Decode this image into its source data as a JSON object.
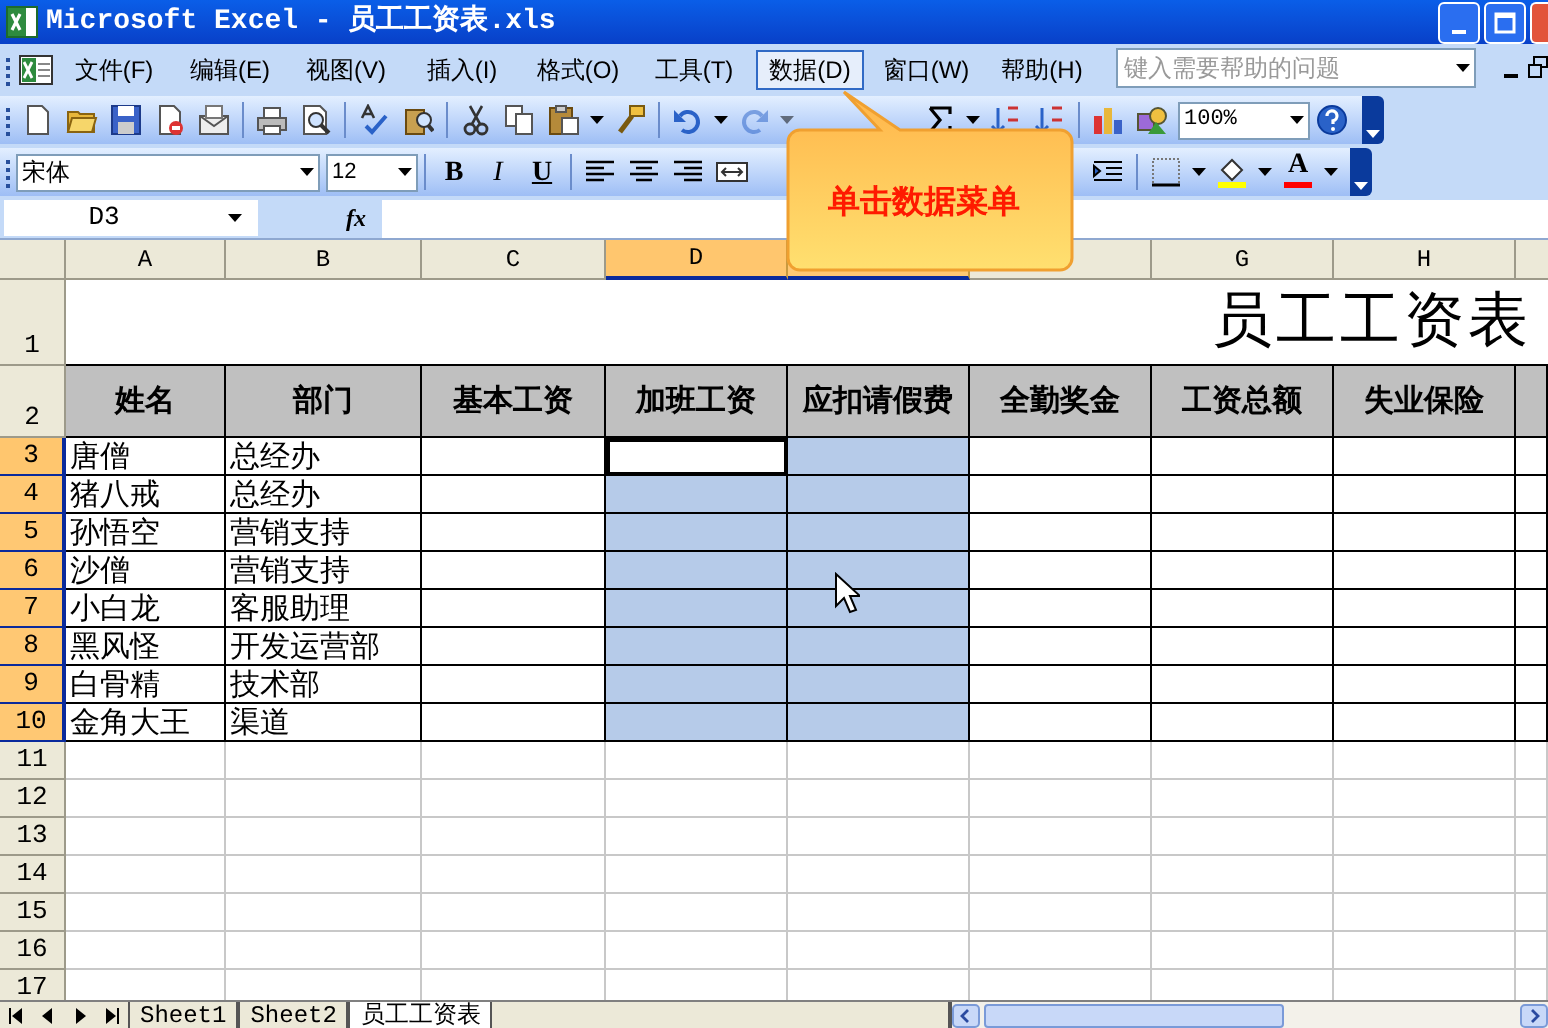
{
  "window": {
    "title": "Microsoft Excel - 员工工资表.xls"
  },
  "menu": [
    {
      "label": "文件(F)",
      "selected": false
    },
    {
      "label": "编辑(E)",
      "selected": false
    },
    {
      "label": "视图(V)",
      "selected": false
    },
    {
      "label": "插入(I)",
      "selected": false
    },
    {
      "label": "格式(O)",
      "selected": false
    },
    {
      "label": "工具(T)",
      "selected": false
    },
    {
      "label": "数据(D)",
      "selected": true
    },
    {
      "label": "窗口(W)",
      "selected": false
    },
    {
      "label": "帮助(H)",
      "selected": false
    }
  ],
  "help_search": {
    "placeholder": "键入需要帮助的问题"
  },
  "zoom_box": {
    "value": "100%"
  },
  "font_box": {
    "value": "宋体"
  },
  "size_box": {
    "value": "12"
  },
  "format_buttons": [
    "B",
    "I",
    "U"
  ],
  "font_color_button": "A",
  "name_box": {
    "value": "D3"
  },
  "formula_label": "fx",
  "callout": {
    "text": "单击数据菜单"
  },
  "sheet": {
    "columns": [
      {
        "label": "A",
        "selected": false,
        "active": false
      },
      {
        "label": "B",
        "selected": false,
        "active": false
      },
      {
        "label": "C",
        "selected": false,
        "active": false
      },
      {
        "label": "D",
        "selected": true,
        "active": true
      },
      {
        "selected": true,
        "active": false
      },
      {
        "selected": false,
        "active": false
      },
      {
        "label": "G",
        "selected": false,
        "active": false
      },
      {
        "label": "H",
        "selected": false,
        "active": false
      }
    ],
    "rows": [
      {
        "label": "1",
        "kind": "title",
        "selected": false,
        "active": false,
        "cells": [
          "",
          "",
          "",
          "",
          "",
          "",
          "员工工资表"
        ]
      },
      {
        "label": "2",
        "kind": "header",
        "selected": false,
        "active": false,
        "cells": [
          "姓名",
          "部门",
          "基本工资",
          "加班工资",
          "应扣请假费",
          "全勤奖金",
          "工资总额",
          "失业保险"
        ]
      },
      {
        "label": "3",
        "kind": "data",
        "selected": true,
        "active": true,
        "cells": [
          "唐僧",
          "总经办"
        ]
      },
      {
        "label": "4",
        "kind": "data",
        "selected": true,
        "active": false,
        "cells": [
          "猪八戒",
          "总经办"
        ]
      },
      {
        "label": "5",
        "kind": "data",
        "selected": true,
        "active": false,
        "cells": [
          "孙悟空",
          "营销支持"
        ]
      },
      {
        "label": "6",
        "kind": "data",
        "selected": true,
        "active": false,
        "cells": [
          "沙僧",
          "营销支持"
        ]
      },
      {
        "label": "7",
        "kind": "data",
        "selected": true,
        "active": false,
        "cells": [
          "小白龙",
          "客服助理"
        ]
      },
      {
        "label": "8",
        "kind": "data",
        "selected": true,
        "active": false,
        "cells": [
          "黑风怪",
          "开发运营部"
        ]
      },
      {
        "label": "9",
        "kind": "data",
        "selected": true,
        "active": false,
        "cells": [
          "白骨精",
          "技术部"
        ]
      },
      {
        "label": "10",
        "kind": "data",
        "selected": true,
        "active": false,
        "cells": [
          "金角大王",
          "渠道"
        ]
      },
      {
        "label": "11",
        "kind": "empty",
        "selected": false,
        "active": false,
        "cells": []
      },
      {
        "label": "12",
        "kind": "empty",
        "selected": false,
        "active": false,
        "cells": []
      },
      {
        "label": "13",
        "kind": "empty",
        "selected": false,
        "active": false,
        "cells": []
      },
      {
        "label": "14",
        "kind": "empty",
        "selected": false,
        "active": false,
        "cells": []
      },
      {
        "label": "15",
        "kind": "empty",
        "selected": false,
        "active": false,
        "cells": []
      },
      {
        "label": "16",
        "kind": "empty",
        "selected": false,
        "active": false,
        "cells": []
      },
      {
        "label": "17",
        "kind": "empty",
        "selected": false,
        "active": false,
        "cells": []
      }
    ]
  },
  "sheet_tabs": [
    {
      "label": "Sheet1",
      "selected": false
    },
    {
      "label": "Sheet2",
      "selected": false
    },
    {
      "label": "员工工资表",
      "selected": true
    }
  ]
}
